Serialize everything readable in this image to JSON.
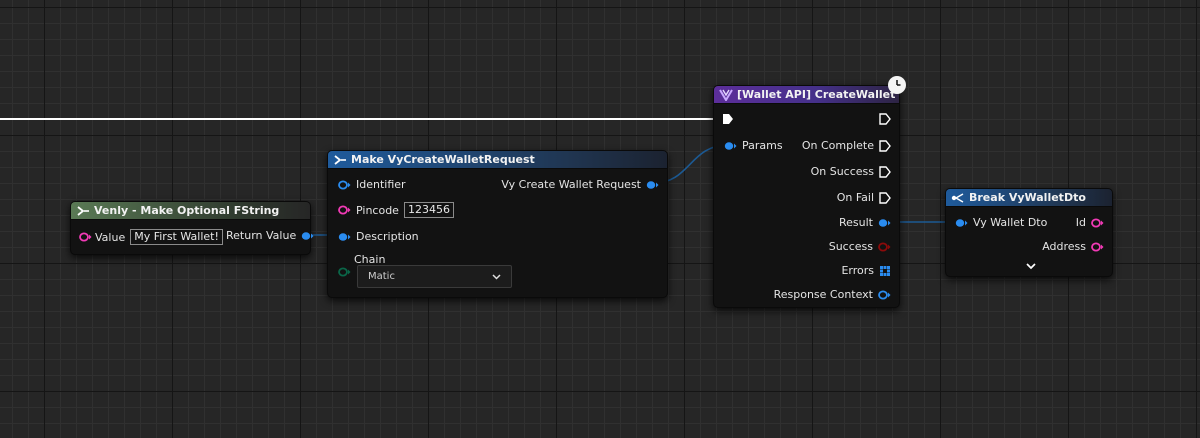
{
  "nodes": {
    "make_optional": {
      "title": "Venly - Make Optional FString",
      "value_label": "Value",
      "value_input": "My First Wallet!",
      "return_label": "Return Value"
    },
    "make_request": {
      "title": "Make VyCreateWalletRequest",
      "identifier_label": "Identifier",
      "pincode_label": "Pincode",
      "pincode_value": "123456",
      "description_label": "Description",
      "chain_label": "Chain",
      "chain_value": "Matic",
      "output_label": "Vy Create Wallet Request"
    },
    "create_wallet": {
      "title": "[Wallet API] CreateWallet",
      "params_label": "Params",
      "on_complete_label": "On Complete",
      "on_success_label": "On Success",
      "on_fail_label": "On Fail",
      "result_label": "Result",
      "success_label": "Success",
      "errors_label": "Errors",
      "response_context_label": "Response Context"
    },
    "break_dto": {
      "title": "Break VyWalletDto",
      "input_label": "Vy Wallet Dto",
      "id_label": "Id",
      "address_label": "Address"
    }
  },
  "colors": {
    "struct_pin": "#2a8cf0",
    "string_pin": "#f23ab6",
    "bool_pin": "#8c0a0a",
    "enum_pin": "#0a6648",
    "exec": "#ffffff",
    "wire_struct": "#1c5a94"
  },
  "icons": {
    "function_icon": "function-icon",
    "venly_logo": "venly-logo-icon",
    "latent_clock": "clock-icon",
    "expand": "chevron-down-icon"
  }
}
